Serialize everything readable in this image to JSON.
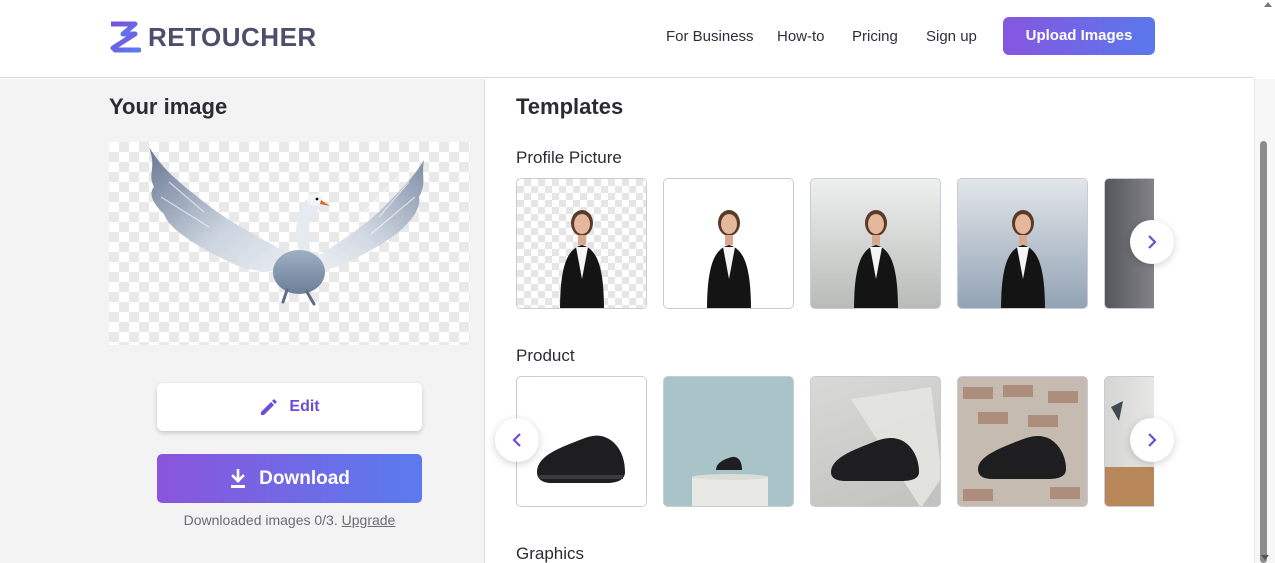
{
  "header": {
    "logo_text": "RETOUCHER",
    "nav": [
      "For Business",
      "How-to",
      "Pricing",
      "Sign up"
    ],
    "upload_label": "Upload Images",
    "brand_colors": {
      "purple": "#8656e0",
      "blue": "#5a78ec"
    }
  },
  "left": {
    "title": "Your image",
    "preview_icon": "swan-cutout-image",
    "edit_label": "Edit",
    "download_label": "Download",
    "download_note": "Downloaded images 0/3.",
    "upgrade_link": "Upgrade"
  },
  "right": {
    "title": "Templates",
    "sections": [
      {
        "title": "Profile Picture",
        "tiles": [
          "transparent",
          "white",
          "light-gray-gradient",
          "blue-gray-gradient",
          "dark-gray-gradient"
        ]
      },
      {
        "title": "Product",
        "tiles": [
          "white",
          "teal-pedestal",
          "gray-studio",
          "brick-wall",
          "lamp-room"
        ]
      },
      {
        "title": "Graphics"
      }
    ]
  }
}
